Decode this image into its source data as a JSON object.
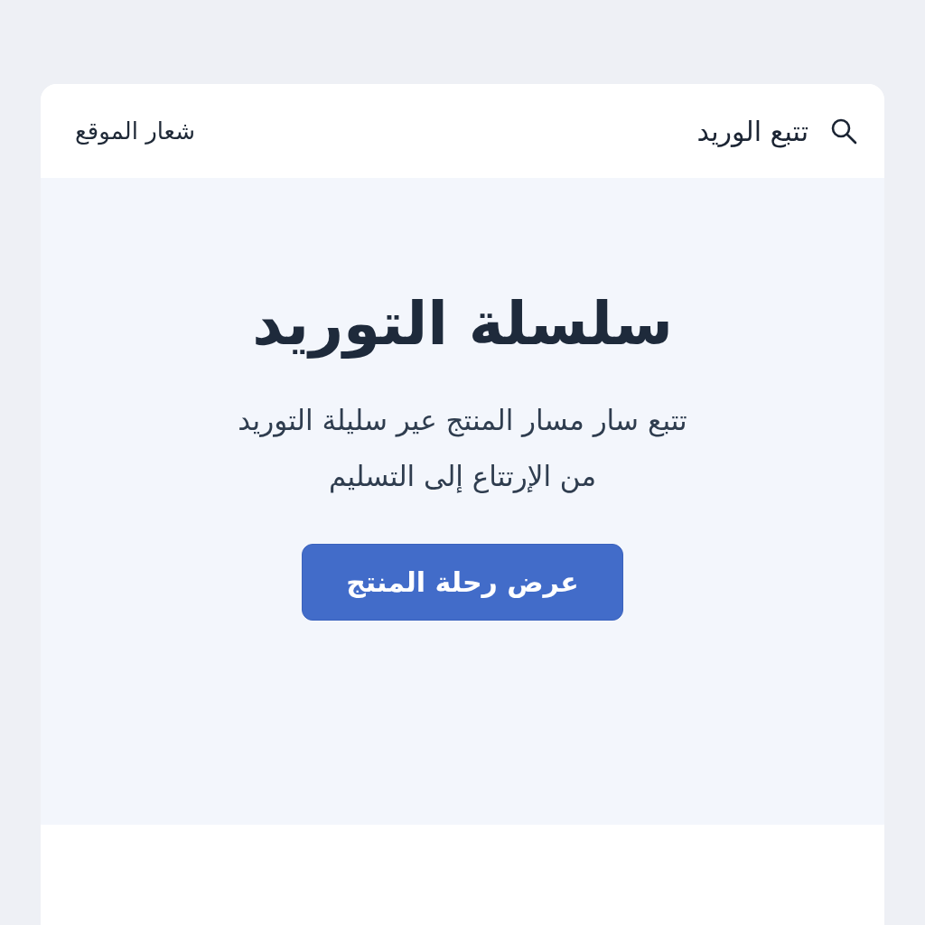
{
  "header": {
    "logo": "شعار الموقع",
    "nav_link": {
      "label": "تتبع الوريد"
    }
  },
  "hero": {
    "title": "سلسلة التوريد",
    "subtitle": "تتبع سار مسار المنتج عير سليلة التوريد من الإرتتاع إلى التسليم",
    "button": {
      "label": "عرض رحلة المنتج"
    }
  }
}
